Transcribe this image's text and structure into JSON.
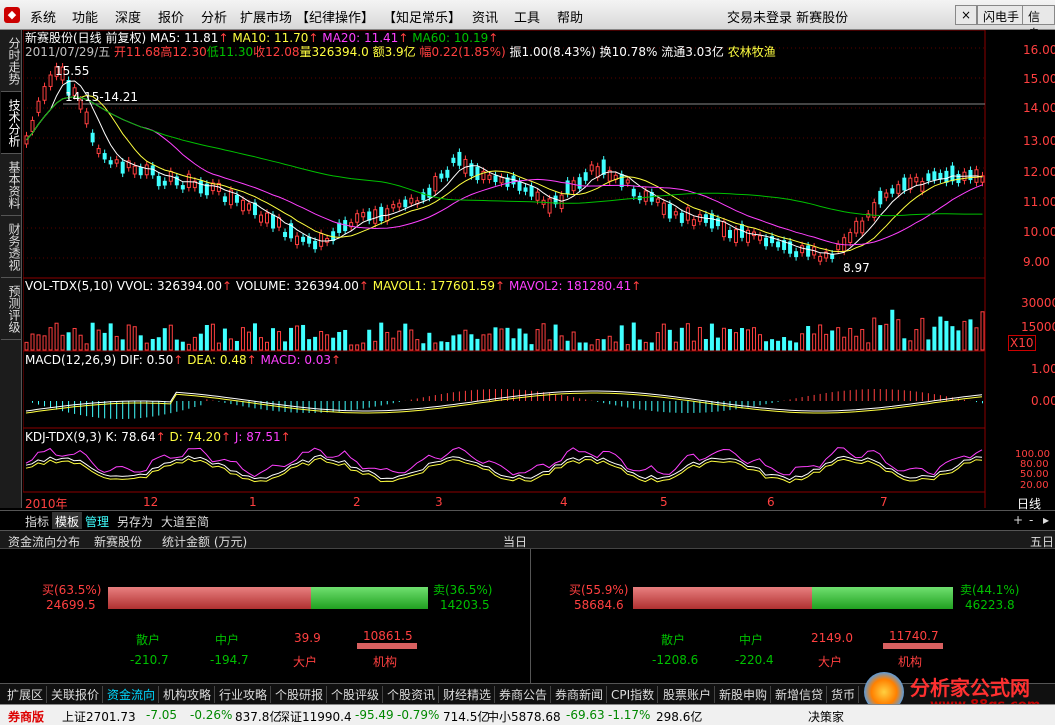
{
  "menubar": {
    "items": [
      "系统",
      "功能",
      "深度",
      "报价",
      "分析",
      "扩展市场",
      "【纪律操作】",
      "【知足常乐】",
      "资讯",
      "工具",
      "帮助"
    ],
    "status": "交易未登录  新赛股份",
    "flash_btn": "闪电手",
    "info_btn": "信息"
  },
  "left_tabs": [
    "分时走势",
    "技术分析",
    "基本资料",
    "财务透视",
    "预测评级"
  ],
  "main_chart": {
    "title": "新赛股份(日线 前复权)",
    "ma5": "MA5: 11.81",
    "ma10": "MA10: 11.70",
    "ma20": "MA20: 11.41",
    "ma60": "MA60: 10.19",
    "date": "2011/07/29/五",
    "open": "开11.68",
    "high": "高12.30",
    "low": "低11.30",
    "close": "收12.08",
    "volume": "量326394.0",
    "amount": "额3.9亿",
    "change": "幅0.22(1.85%)",
    "amplitude": "振1.00(8.43%)",
    "turnover": "换10.78%",
    "float": "流通3.03亿",
    "sector": "农林牧渔",
    "hi_label": "15.55",
    "range_label": "14.15-14.21",
    "lo_label": "8.97",
    "y_ticks": [
      "16.00",
      "15.00",
      "14.00",
      "13.00",
      "12.00",
      "11.00",
      "10.00",
      "9.00"
    ]
  },
  "vol_panel": {
    "title": "VOL-TDX(5,10)",
    "vvol": "VVOL: 326394.00",
    "volume": "VOLUME: 326394.00",
    "mavol1": "MAVOL1: 177601.59",
    "mavol2": "MAVOL2: 181280.41",
    "y_ticks": [
      "30000",
      "15000"
    ],
    "unit": "X10"
  },
  "macd_panel": {
    "title": "MACD(12,26,9)",
    "dif": "DIF: 0.50",
    "dea": "DEA: 0.48",
    "macd": "MACD: 0.03",
    "y_ticks": [
      "1.00",
      "0.00"
    ]
  },
  "kdj_panel": {
    "title": "KDJ-TDX(9,3)",
    "k": "K: 78.64",
    "d": "D: 74.20",
    "j": "J: 87.51",
    "y_ticks": [
      "100.00",
      "80.00",
      "50.00",
      "20.00"
    ]
  },
  "x_axis": {
    "labels": [
      "2010年",
      "12",
      "1",
      "2",
      "3",
      "4",
      "5",
      "6",
      "7"
    ],
    "period": "日线"
  },
  "toolstrip": [
    "指标",
    "模板",
    "管理",
    "另存为",
    "大道至简"
  ],
  "fund_flow": {
    "title": "资金流向分布",
    "stock": "新赛股份",
    "unit": "统计金额 (万元)",
    "today_label": "当日",
    "five_label": "五日",
    "today": {
      "buy_label": "买(63.5%)",
      "buy_value": "24699.5",
      "sell_label": "卖(36.5%)",
      "sell_value": "14203.5",
      "buy_pct": 63.5,
      "retail": "散户",
      "mid": "中户",
      "big_val": "39.9",
      "inst_val": "10861.5",
      "retail_val": "-210.7",
      "mid_val": "-194.7",
      "big": "大户",
      "inst": "机构"
    },
    "five": {
      "buy_label": "买(55.9%)",
      "buy_value": "58684.6",
      "sell_label": "卖(44.1%)",
      "sell_value": "46223.8",
      "buy_pct": 55.9,
      "retail": "散户",
      "mid": "中户",
      "big_val": "2149.0",
      "inst_val": "11740.7",
      "retail_val": "-1208.6",
      "mid_val": "-220.4",
      "big": "大户",
      "inst": "机构"
    }
  },
  "bottom_tabs": [
    "扩展区",
    "关联报价",
    "资金流向",
    "机构攻略",
    "行业攻略",
    "个股研报",
    "个股评级",
    "个股资讯",
    "财经精选",
    "券商公告",
    "券商新闻",
    "CPI指数",
    "股票账户",
    "新股申购",
    "新增信贷",
    "货币"
  ],
  "status_bar": {
    "brand": "券商版",
    "sh": "上证2701.73",
    "sh_chg": "-7.05",
    "sh_pct": "-0.26%",
    "sh_amt": "837.8亿",
    "sz": "深证11990.4",
    "sz_chg": "-95.49",
    "sz_pct": "-0.79%",
    "sz_amt": "714.5亿",
    "zx": "中小5878.68",
    "zx_chg": "-69.63",
    "zx_pct": "-1.17%",
    "zx_amt": "298.6亿",
    "decision": "决策家"
  },
  "watermark": {
    "site": "分析家公式网",
    "url": "www.88gs.com"
  },
  "colors": {
    "up": "#ff4040",
    "down": "#40ffff",
    "ma5": "#ffffff",
    "ma10": "#ffff40",
    "ma20": "#ff40ff",
    "ma60": "#00c000"
  }
}
